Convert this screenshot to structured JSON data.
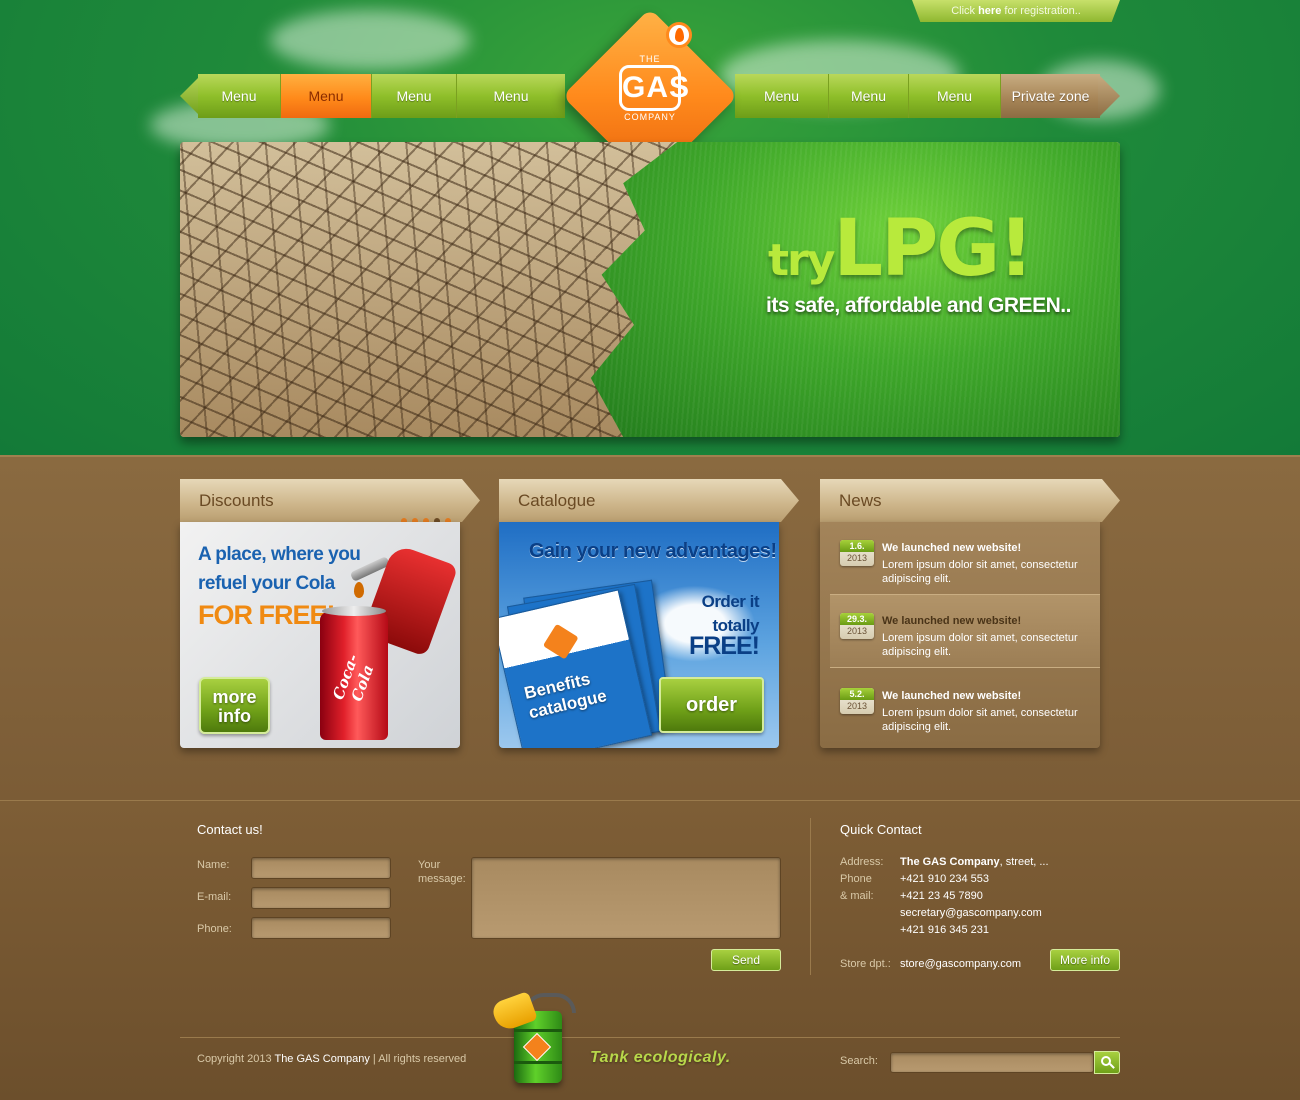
{
  "header": {
    "register": {
      "prefix": "Click ",
      "link": "here",
      "suffix": " for registration.."
    },
    "nav_left": [
      "Menu",
      "Menu",
      "Menu",
      "Menu"
    ],
    "nav_right": [
      "Menu",
      "Menu",
      "Menu",
      "Private zone"
    ],
    "active_index": 1,
    "logo": {
      "the": "THE",
      "gas": "GAS",
      "company": "COMPANY"
    },
    "banner": {
      "try": "try",
      "lpg": "LPG!",
      "tagline": "its safe, affordable and GREEN.."
    }
  },
  "boxes": {
    "discounts": {
      "title": "Discounts",
      "line1": "A place, where you",
      "line2": "refuel your Cola",
      "free": "FOR FREE!",
      "button_line1": "more",
      "button_line2": "info",
      "can_brand": "Coca-Cola"
    },
    "catalogue": {
      "title": "Catalogue",
      "headline": "Gain your new advantages!",
      "order_line1": "Order it",
      "order_line2": "totally",
      "order_free": "FREE!",
      "booklet_line1": "Benefits",
      "booklet_line2": "catalogue",
      "button": "order",
      "booklet_logo": "GAS"
    },
    "news": {
      "title": "News",
      "items": [
        {
          "day": "1.6.",
          "year": "2013",
          "title": "We launched new website!",
          "text": "Lorem ipsum dolor sit amet, consectetur adipiscing elit."
        },
        {
          "day": "29.3.",
          "year": "2013",
          "title": "We launched new website!",
          "text": "Lorem ipsum dolor sit amet, consectetur adipiscing elit."
        },
        {
          "day": "5.2.",
          "year": "2013",
          "title": "We launched new website!",
          "text": "Lorem ipsum dolor sit amet, consectetur adipiscing elit."
        }
      ]
    }
  },
  "contact": {
    "heading": "Contact us!",
    "name_label": "Name:",
    "email_label": "E-mail:",
    "phone_label": "Phone:",
    "message_label_1": "Your",
    "message_label_2": "message:",
    "send": "Send"
  },
  "quick_contact": {
    "heading": "Quick Contact",
    "address_label": "Address:",
    "address_company": "The GAS Company",
    "address_rest": ", street, ...",
    "phone_label": "Phone",
    "mail_label": "& mail:",
    "phone1": "+421 910 234 553",
    "phone2": "+421 23 45 7890",
    "email": "secretary@gascompany.com",
    "phone3": "+421 916 345 231",
    "store_label": "Store dpt.:",
    "store_email": "store@gascompany.com",
    "more_info": "More info"
  },
  "footer": {
    "copyright_prefix": "Copyright 2013 ",
    "company": "The GAS Company",
    "rights": "  |  All rights reserved",
    "slogan": "Tank ecologicaly.",
    "search_label": "Search:"
  },
  "colors": {
    "header_green": "#1f8a3a",
    "nav_green": "#8fbf2a",
    "accent_orange": "#ff8a1a",
    "brown_bg": "#7b5c36",
    "button_green": "#6fa018"
  }
}
